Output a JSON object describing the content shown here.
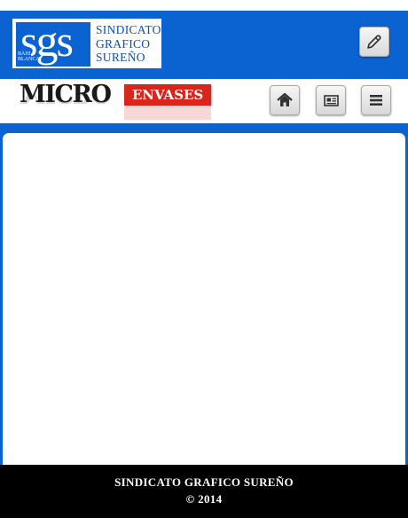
{
  "header": {
    "logo": {
      "monogram": "sgs",
      "city_line1": "BAHIA",
      "city_line2": "BLANCA",
      "name_lines": [
        "SINDICATO",
        "GRAFICO",
        "SUREÑO"
      ]
    },
    "edit_icon": "pencil-edit-icon"
  },
  "sub_header": {
    "brand_part1": "MICRO",
    "brand_part2": "ENVASES",
    "home_icon": "home-icon",
    "news_icon": "newspaper-icon",
    "menu_icon": "hamburger-menu-icon"
  },
  "colors": {
    "brand_blue": "#0b62d1",
    "accent_red": "#d9261c",
    "footer_bg": "#000000"
  },
  "footer": {
    "title": "SINDICATO GRAFICO SUREÑO",
    "copyright": "© 2014"
  }
}
